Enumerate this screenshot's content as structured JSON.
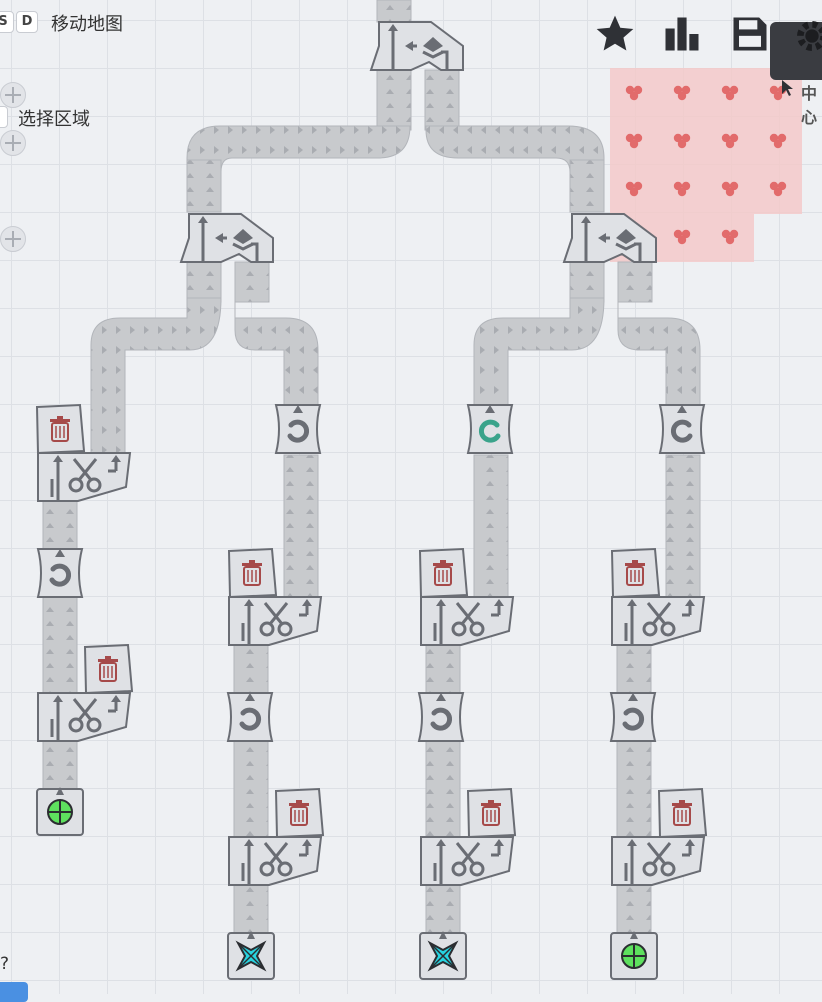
{
  "hud": {
    "key_s": "S",
    "key_d": "D",
    "move_map_label": "移动地图",
    "select_area_label": "选择区域",
    "corner_text": "中心",
    "help_text": "?"
  },
  "toolbar": {
    "star_icon": "star-icon",
    "stats_icon": "bar-chart-icon",
    "save_icon": "save-icon",
    "settings_icon": "gear-icon"
  },
  "colors": {
    "belt": "#c8cacd",
    "building": "#dfe1e5",
    "building_stroke": "#6a6d74",
    "ore_zone": "#f3c9c9",
    "ore": "#e26b6b",
    "trash": "#a64a4a",
    "rotator_ccw": "#3aa38b",
    "extractor_green": "#5ee05e",
    "extractor_cyan": "#27d4e0"
  },
  "machines": {
    "balancers": [
      "balancer-top",
      "balancer-left",
      "balancer-right"
    ],
    "columns": [
      {
        "name": "column-1",
        "output": "extractor-green"
      },
      {
        "name": "column-2",
        "output": "extractor-cyan"
      },
      {
        "name": "column-3",
        "output": "extractor-cyan"
      },
      {
        "name": "column-4",
        "output": "extractor-green"
      }
    ]
  }
}
